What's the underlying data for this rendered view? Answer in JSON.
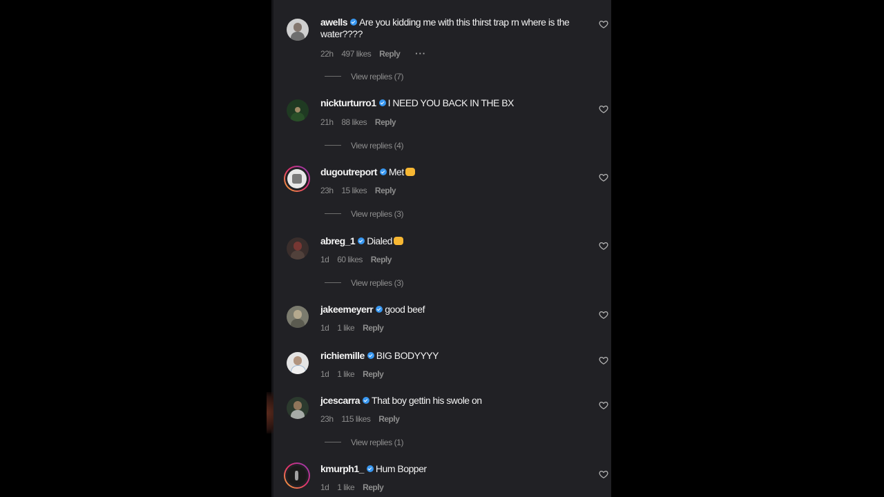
{
  "colors": {
    "background": "#000000",
    "panel": "#212125",
    "verified_badge": "#3897f0",
    "muted_text": "#8e8e8e",
    "story_ring_start": "#f9b233",
    "story_ring_end": "#8a3ab9"
  },
  "icons": {
    "like": "heart-icon",
    "verified": "verified-badge-icon",
    "more": "more-options-icon"
  },
  "comments": [
    {
      "username": "awells",
      "text": "Are you kidding me with this thirst trap rn where is the water????",
      "time": "22h",
      "likes": "497 likes",
      "reply": "Reply",
      "more": "···",
      "view_replies": "View replies (7)"
    },
    {
      "username": "nickturturro1",
      "text": "I NEED YOU BACK IN THE BX",
      "time": "21h",
      "likes": "88 likes",
      "reply": "Reply",
      "view_replies": "View replies (4)"
    },
    {
      "username": "dugoutreport",
      "text": "Met",
      "time": "23h",
      "likes": "15 likes",
      "reply": "Reply",
      "view_replies": "View replies (3)"
    },
    {
      "username": "abreg_1",
      "text": "Dialed",
      "time": "1d",
      "likes": "60 likes",
      "reply": "Reply",
      "view_replies": "View replies (3)"
    },
    {
      "username": "jakeemeyerr",
      "text": "good beef",
      "time": "1d",
      "likes": "1 like",
      "reply": "Reply"
    },
    {
      "username": "richiemille",
      "text": "BIG BODYYYY",
      "time": "1d",
      "likes": "1 like",
      "reply": "Reply"
    },
    {
      "username": "jcescarra",
      "text": "That boy gettin his swole on",
      "time": "23h",
      "likes": "115 likes",
      "reply": "Reply",
      "view_replies": "View replies (1)"
    },
    {
      "username": "kmurph1_",
      "text": "Hum Bopper",
      "time": "1d",
      "likes": "1 like",
      "reply": "Reply"
    }
  ]
}
